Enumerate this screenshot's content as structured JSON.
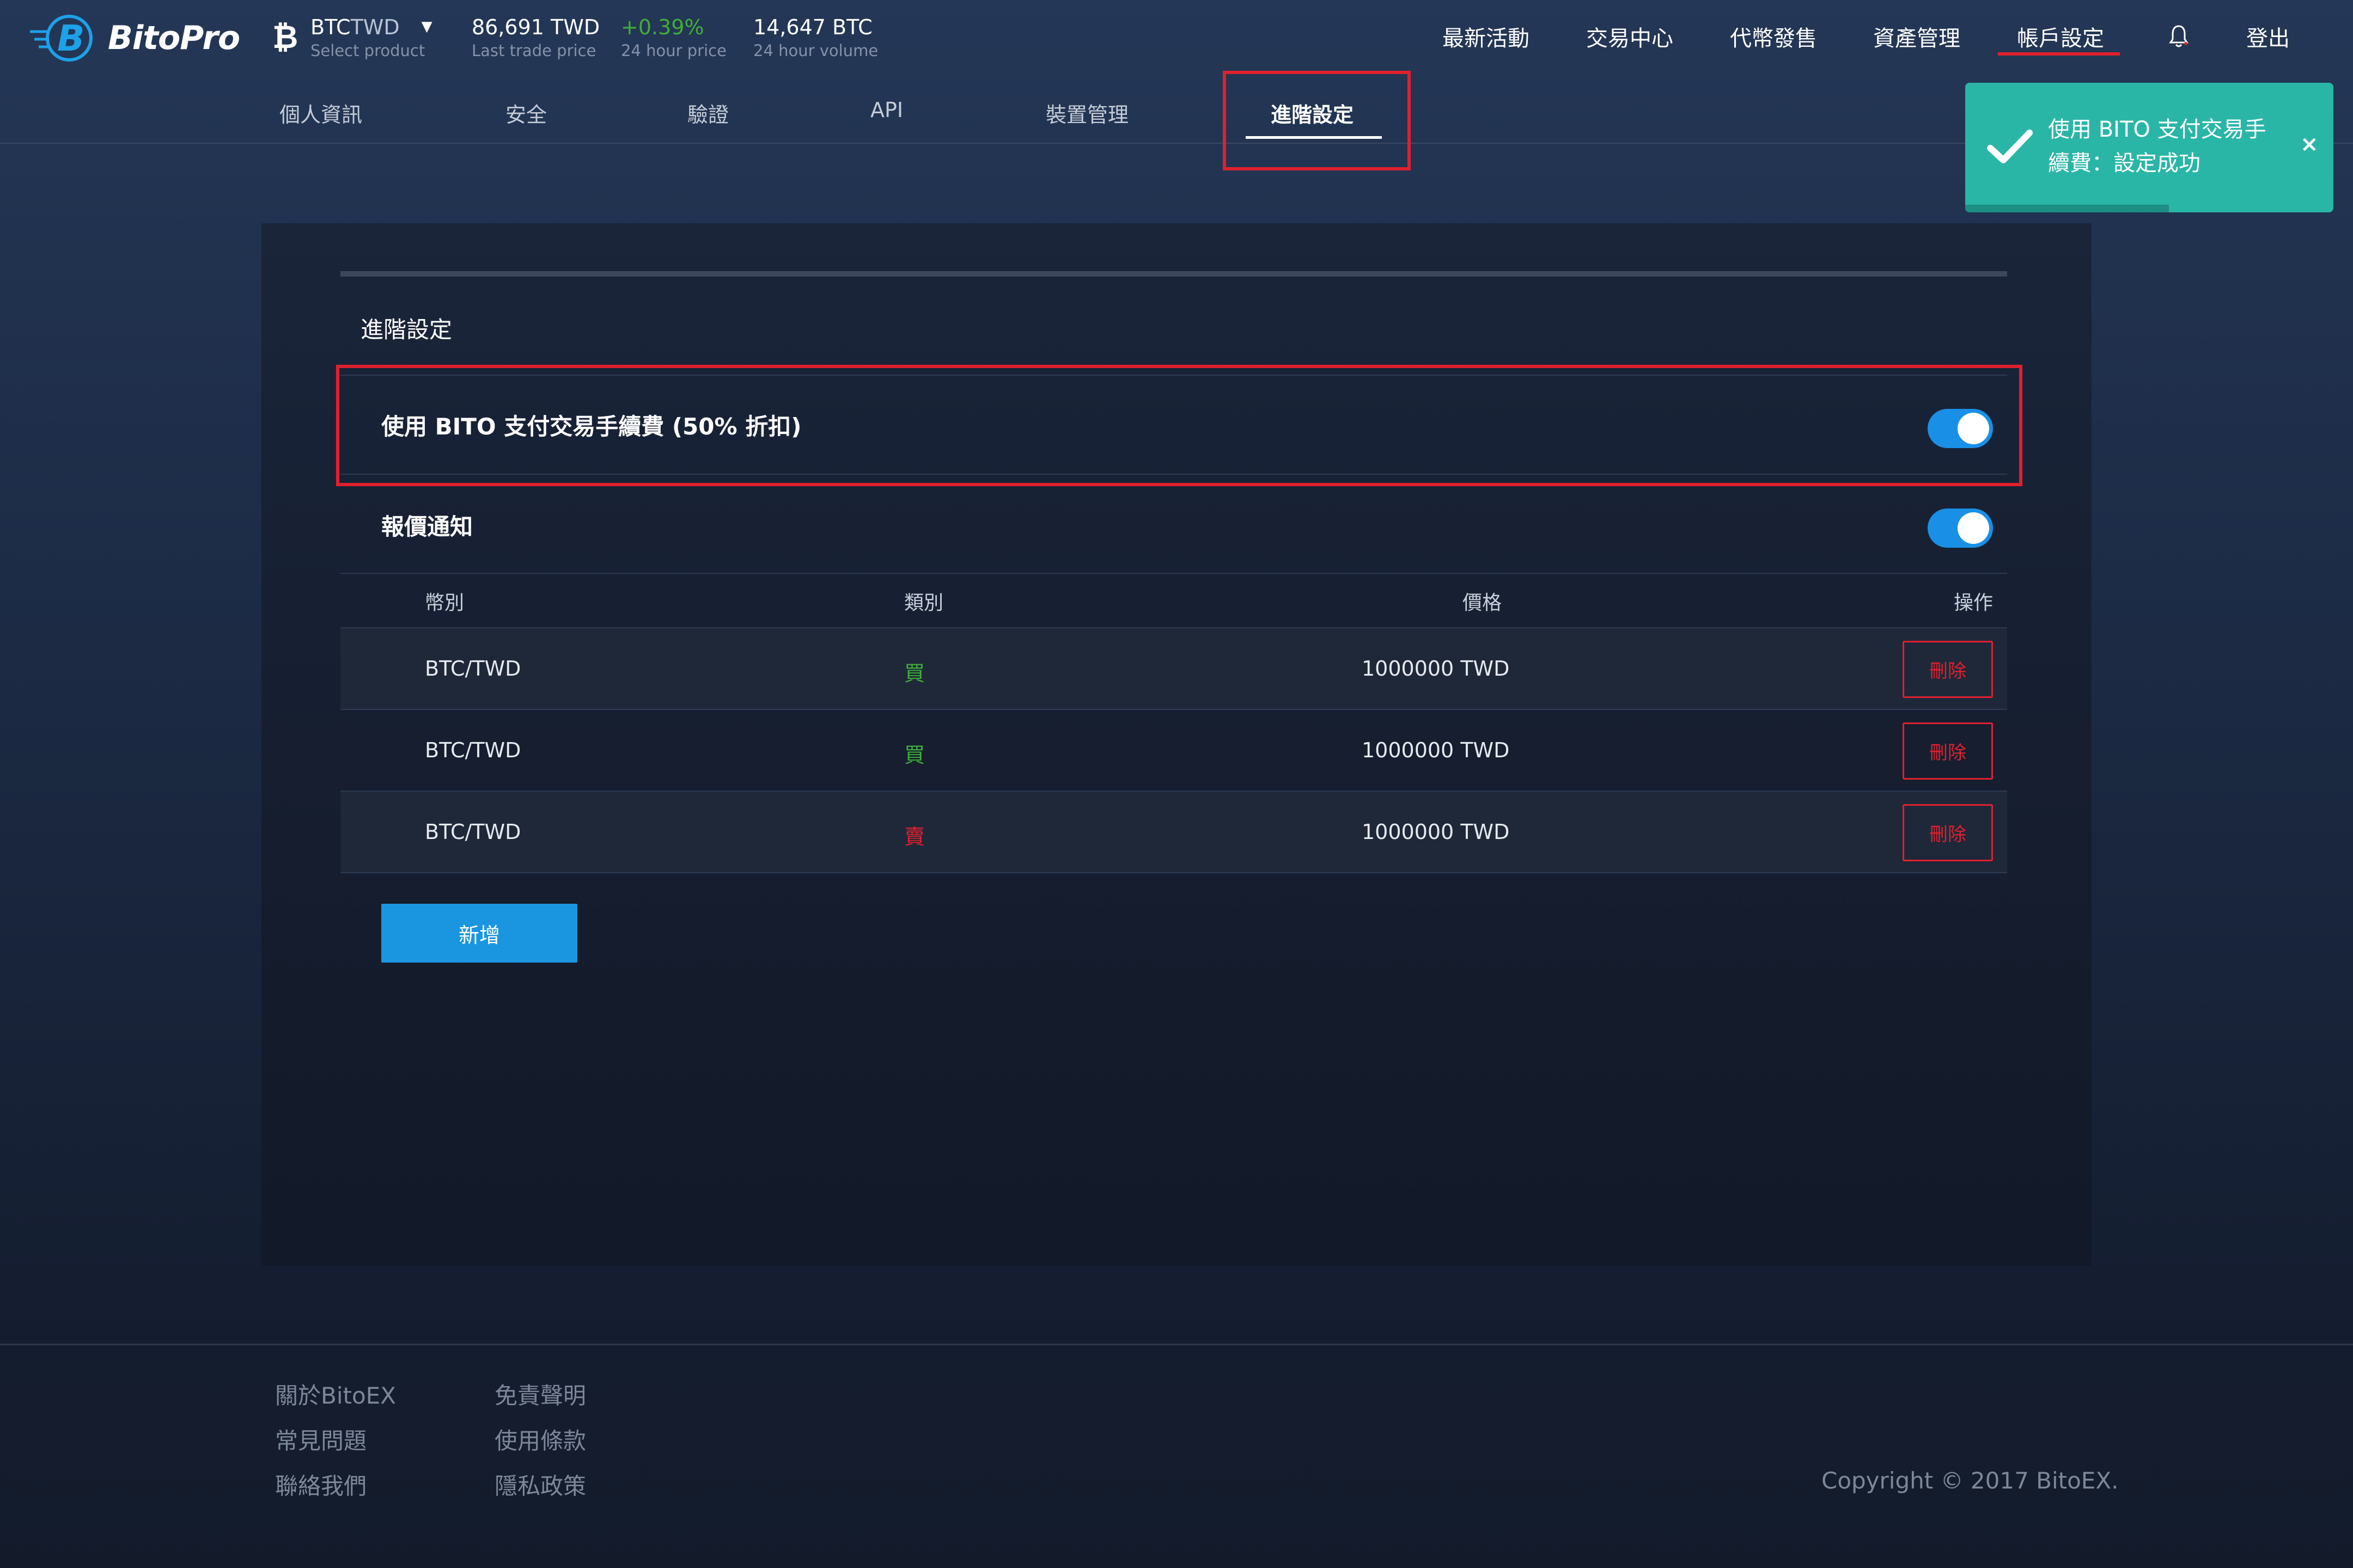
{
  "brand": {
    "name": "BitoPro"
  },
  "ticker": {
    "coin_icon": "bitcoin-icon",
    "base": "BTC",
    "quote": "TWD",
    "select_label": "Select product",
    "last_price": "86,691 TWD",
    "last_price_label": "Last trade price",
    "change": "+0.39%",
    "change_label": "24 hour price",
    "volume": "14,647 BTC",
    "volume_label": "24 hour volume"
  },
  "nav": {
    "items": [
      "最新活動",
      "交易中心",
      "代幣發售",
      "資產管理",
      "帳戶設定"
    ],
    "active_index": 4,
    "bell_icon": "bell-icon",
    "logout": "登出"
  },
  "tabs": {
    "items": [
      "個人資訊",
      "安全",
      "驗證",
      "API",
      "裝置管理",
      "進階設定"
    ],
    "active_index": 5
  },
  "toast": {
    "icon": "check-icon",
    "message": "使用 BITO 支付交易手續費：設定成功",
    "close": "×",
    "color": "#2ab6a7"
  },
  "panel": {
    "title": "進階設定",
    "settings": [
      {
        "label": "使用 BITO 支付交易手續費 (50% 折扣)",
        "enabled": true
      },
      {
        "label": "報價通知",
        "enabled": true
      }
    ],
    "table": {
      "headers": [
        "幣別",
        "類別",
        "價格",
        "操作"
      ],
      "rows": [
        {
          "pair": "BTC/TWD",
          "side": "買",
          "side_type": "buy",
          "price": "1000000 TWD",
          "action": "刪除"
        },
        {
          "pair": "BTC/TWD",
          "side": "買",
          "side_type": "buy",
          "price": "1000000 TWD",
          "action": "刪除"
        },
        {
          "pair": "BTC/TWD",
          "side": "賣",
          "side_type": "sell",
          "price": "1000000 TWD",
          "action": "刪除"
        }
      ]
    },
    "add_button": "新增"
  },
  "footer": {
    "col1": [
      "關於BitoEX",
      "常見問題",
      "聯絡我們"
    ],
    "col2": [
      "免責聲明",
      "使用條款",
      "隱私政策"
    ],
    "copyright": "Copyright © 2017 BitoEX."
  },
  "colors": {
    "accent_red": "#e0202e",
    "toggle_blue": "#1990e6",
    "buy_green": "#3fae39",
    "button_blue": "#1a96e0"
  }
}
